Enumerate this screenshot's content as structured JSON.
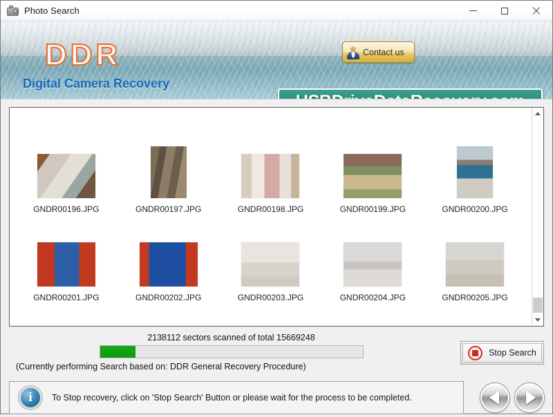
{
  "window": {
    "title": "Photo Search",
    "icon": "camera-icon",
    "controls": {
      "minimize": "—",
      "maximize": "□",
      "close": "✕"
    }
  },
  "header": {
    "logo": "DDR",
    "tagline": "Digital Camera Recovery",
    "contact_button": {
      "label": "Contact us",
      "icon": "user-avatar-icon"
    },
    "url_banner": "USBDriveDataRecovery.com",
    "colors": {
      "logo_outline": "#ef6b23",
      "tagline": "#1668b8",
      "url_banner_bg": "#2d8d7c",
      "contact_button_bg": "#e8c765"
    }
  },
  "thumbnails": {
    "rows": [
      [
        {
          "name": "GNDR00196.JPG",
          "orientation": "landscape"
        },
        {
          "name": "GNDR00197.JPG",
          "orientation": "portrait"
        },
        {
          "name": "GNDR00198.JPG",
          "orientation": "landscape"
        },
        {
          "name": "GNDR00199.JPG",
          "orientation": "landscape"
        },
        {
          "name": "GNDR00200.JPG",
          "orientation": "portrait"
        }
      ],
      [
        {
          "name": "GNDR00201.JPG",
          "orientation": "landscape"
        },
        {
          "name": "GNDR00202.JPG",
          "orientation": "landscape"
        },
        {
          "name": "GNDR00203.JPG",
          "orientation": "landscape"
        },
        {
          "name": "GNDR00204.JPG",
          "orientation": "landscape"
        },
        {
          "name": "GNDR00205.JPG",
          "orientation": "landscape"
        }
      ]
    ]
  },
  "progress": {
    "scan_text": "2138112 sectors scanned of total 15669248",
    "sectors_scanned": 2138112,
    "sectors_total": 15669248,
    "percent": 13.6,
    "bar_color": "#0f9a12",
    "procedure_text": "(Currently performing Search based on:  DDR General Recovery Procedure)"
  },
  "stop_button": {
    "label": "Stop Search",
    "icon": "stop-square-icon",
    "color": "#d7271b"
  },
  "footer": {
    "info_icon": "info-icon",
    "info_glyph": "i",
    "message": "To Stop recovery, click on 'Stop Search' Button or please wait for the process to be completed.",
    "nav": {
      "back": "previous-arrow",
      "next": "next-arrow"
    }
  },
  "scrollbar": {
    "up": "chevron-up-icon",
    "down": "chevron-down-icon",
    "position": "bottom"
  }
}
